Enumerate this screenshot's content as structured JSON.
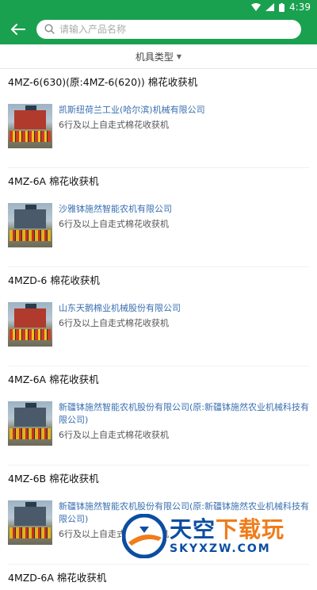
{
  "status_bar": {
    "time": "4:39"
  },
  "header": {
    "back_icon": "back-arrow-icon",
    "search_placeholder": "请输入产品名称",
    "search_icon": "search-icon"
  },
  "filter": {
    "label": "机具类型",
    "caret_icon": "caret-down-icon"
  },
  "products": [
    {
      "title": "4MZ-6(630)(原:4MZ-6(620)) 棉花收获机",
      "company": "凯斯纽荷兰工业(哈尔滨)机械有限公司",
      "desc": "6行及以上自走式棉花收获机"
    },
    {
      "title": "4MZ-6A 棉花收获机",
      "company": "沙雅钵施然智能农机有限公司",
      "desc": "6行及以上自走式棉花收获机"
    },
    {
      "title": "4MZD-6 棉花收获机",
      "company": "山东天鹅棉业机械股份有限公司",
      "desc": "6行及以上自走式棉花收获机"
    },
    {
      "title": "4MZ-6A 棉花收获机",
      "company": "新疆钵施然智能农机股份有限公司(原:新疆钵施然农业机械科技有限公司)",
      "desc": "6行及以上自走式棉花收获机"
    },
    {
      "title": "4MZ-6B 棉花收获机",
      "company": "新疆钵施然智能农机股份有限公司(原:新疆钵施然农业机械科技有限公司)",
      "desc": "6行及以上自走式棉花收获机"
    },
    {
      "title": "4MZD-6A 棉花收获机"
    }
  ],
  "watermark": {
    "name_part1": "天空",
    "name_part2": "下载玩",
    "url": "SKYXZW.COM"
  },
  "colors": {
    "primary": "#1aa150",
    "company_link": "#3a6fb0"
  }
}
